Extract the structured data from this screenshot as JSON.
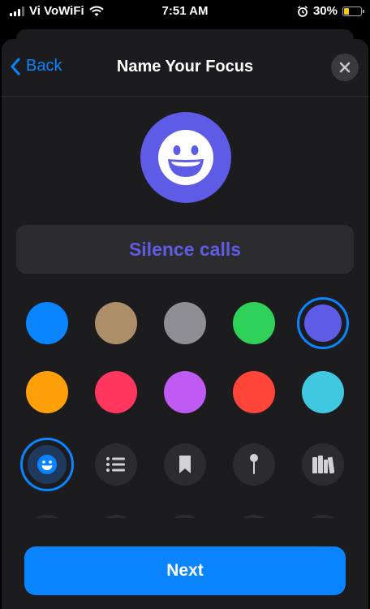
{
  "status_bar": {
    "carrier": "Vi VoWiFi",
    "time": "7:51 AM",
    "battery_percent": "30%",
    "battery_level": 0.3,
    "icons": [
      "signal-icon",
      "wifi-icon",
      "alarm-icon",
      "battery-icon"
    ]
  },
  "nav": {
    "back_label": "Back",
    "title": "Name Your Focus",
    "close_icon": "close-icon"
  },
  "focus": {
    "icon": "smiley-icon",
    "name": "Silence calls",
    "accent": "#5E5CE6"
  },
  "colors": {
    "selected": "purple",
    "options": [
      {
        "name": "blue",
        "hex": "#0A84FF"
      },
      {
        "name": "tan",
        "hex": "#AC8E68"
      },
      {
        "name": "gray",
        "hex": "#8E8E93"
      },
      {
        "name": "green",
        "hex": "#30D158"
      },
      {
        "name": "purple",
        "hex": "#5E5CE6"
      },
      {
        "name": "orange",
        "hex": "#FF9F0A"
      },
      {
        "name": "pink",
        "hex": "#FF375F"
      },
      {
        "name": "violet",
        "hex": "#BF5AF2"
      },
      {
        "name": "red",
        "hex": "#FF453A"
      },
      {
        "name": "teal",
        "hex": "#40C8E0"
      }
    ]
  },
  "icons": {
    "selected": "smiley-icon",
    "options": [
      "smiley-icon",
      "list-icon",
      "bookmark-icon",
      "pin-icon",
      "books-icon"
    ]
  },
  "footer": {
    "next_label": "Next"
  }
}
